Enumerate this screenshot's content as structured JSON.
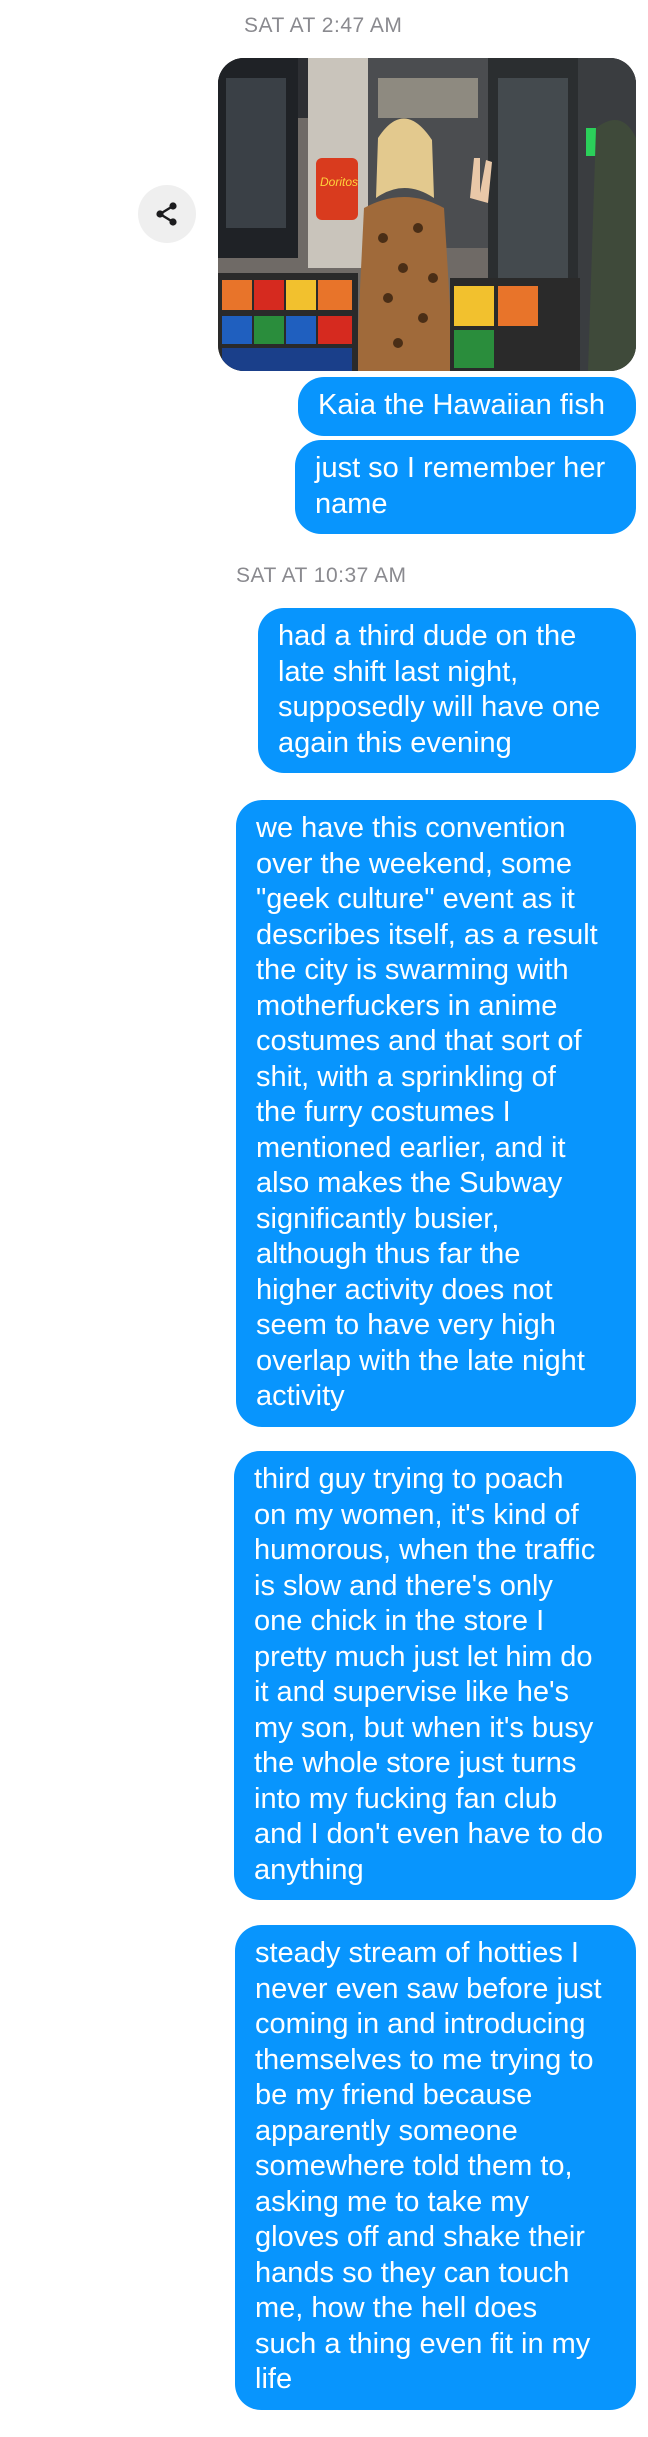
{
  "thread": {
    "timestamp_1": "SAT AT 2:47 AM",
    "timestamp_2": "SAT AT 10:37 AM",
    "photo_sign_text": "Doritos",
    "messages": [
      {
        "text": "Kaia the Hawaiian fish"
      },
      {
        "text": "just so I remember her\nname"
      },
      {
        "text": "had a third dude on the\nlate shift last night,\nsupposedly will have one\nagain this evening"
      },
      {
        "text": "we have this convention\nover the weekend, some\n\"geek culture\" event as it\ndescribes itself, as a result\nthe city is swarming with\nmotherfuckers in anime\ncostumes and that sort of\nshit, with a sprinkling of\nthe furry costumes I\nmentioned earlier, and it\nalso makes the Subway\nsignificantly busier,\nalthough thus far the\nhigher activity does not\nseem to have very high\noverlap with the late night\nactivity"
      },
      {
        "text": "third guy trying to poach\non my women, it's kind of\nhumorous, when the traffic\nis slow and there's only\none chick in the store I\npretty much just let him do\nit and supervise like he's\nmy son, but when it's busy\nthe whole store just turns\ninto my fucking fan club\nand I don't even have to do\nanything"
      },
      {
        "text": "steady stream of hotties I\nnever even saw before just\ncoming in and introducing\nthemselves to me trying to\nbe my friend because\napparently someone\nsomewhere told them to,\nasking me to take my\ngloves off and shake their\nhands so they can touch\nme, how the hell does\nsuch a thing even fit in my\nlife"
      }
    ],
    "colors": {
      "sent_bubble": "#0895fd",
      "timestamp_text": "#8a8a8f",
      "share_button_bg": "#efefef"
    },
    "icons": {
      "share": "share-icon"
    }
  }
}
